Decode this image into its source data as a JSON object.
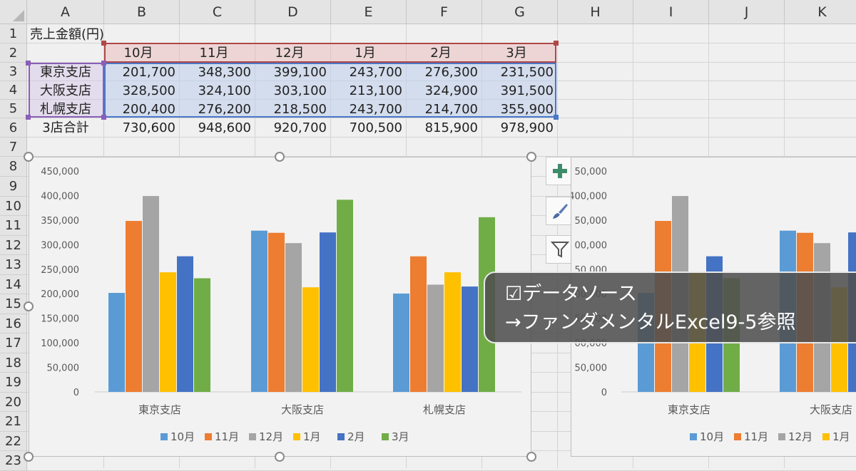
{
  "columns": [
    "A",
    "B",
    "C",
    "D",
    "E",
    "F",
    "G",
    "H",
    "I",
    "J",
    "K"
  ],
  "rows": [
    "1",
    "2",
    "3",
    "4",
    "5",
    "6",
    "7",
    "8",
    "9",
    "10",
    "11",
    "12",
    "13",
    "14",
    "15",
    "16",
    "17",
    "18",
    "19",
    "20",
    "21",
    "22",
    "23"
  ],
  "sheet": {
    "title": "売上金額(円)",
    "months": [
      "10月",
      "11月",
      "12月",
      "1月",
      "2月",
      "3月"
    ],
    "branches": [
      {
        "name": "東京支店",
        "values": [
          "201,700",
          "348,300",
          "399,100",
          "243,700",
          "276,300",
          "231,500"
        ]
      },
      {
        "name": "大阪支店",
        "values": [
          "328,500",
          "324,100",
          "303,100",
          "213,100",
          "324,900",
          "391,500"
        ]
      },
      {
        "name": "札幌支店",
        "values": [
          "200,400",
          "276,200",
          "218,500",
          "243,700",
          "214,700",
          "355,900"
        ]
      }
    ],
    "total": {
      "name": "3店合計",
      "values": [
        "730,600",
        "948,600",
        "920,700",
        "700,500",
        "815,900",
        "978,900"
      ]
    }
  },
  "chart_data": {
    "type": "bar",
    "categories": [
      "東京支店",
      "大阪支店",
      "札幌支店"
    ],
    "series": [
      {
        "name": "10月",
        "color": "#5b9bd5",
        "values": [
          201700,
          328500,
          200400
        ]
      },
      {
        "name": "11月",
        "color": "#ed7d31",
        "values": [
          348300,
          324100,
          276200
        ]
      },
      {
        "name": "12月",
        "color": "#a5a5a5",
        "values": [
          399100,
          303100,
          218500
        ]
      },
      {
        "name": "1月",
        "color": "#ffc000",
        "values": [
          243700,
          213100,
          243700
        ]
      },
      {
        "name": "2月",
        "color": "#4472c4",
        "values": [
          276300,
          324900,
          214700
        ]
      },
      {
        "name": "3月",
        "color": "#70ad47",
        "values": [
          231500,
          391500,
          355900
        ]
      }
    ],
    "y_ticks": [
      "450,000",
      "400,000",
      "350,000",
      "300,000",
      "250,000",
      "200,000",
      "150,000",
      "100,000",
      "50,000",
      "0"
    ],
    "ylim": [
      0,
      450000
    ],
    "legend": "bottom",
    "grid": false
  },
  "chart_copy": {
    "y_ticks": [
      "50,000",
      "400,000",
      "50,000",
      "00,000",
      "50,000",
      "00,000",
      "50,000",
      "00,000",
      "50,000",
      "0"
    ],
    "categories": [
      "東京支店",
      "大阪支店"
    ],
    "legend": [
      "10月",
      "11月",
      "12月",
      "1月"
    ]
  },
  "overlay": {
    "line1": "☑データソース",
    "line2": "→ファンダメンタルExcel9-5参照"
  },
  "side_buttons": [
    "plus-icon",
    "brush-icon",
    "filter-icon"
  ]
}
